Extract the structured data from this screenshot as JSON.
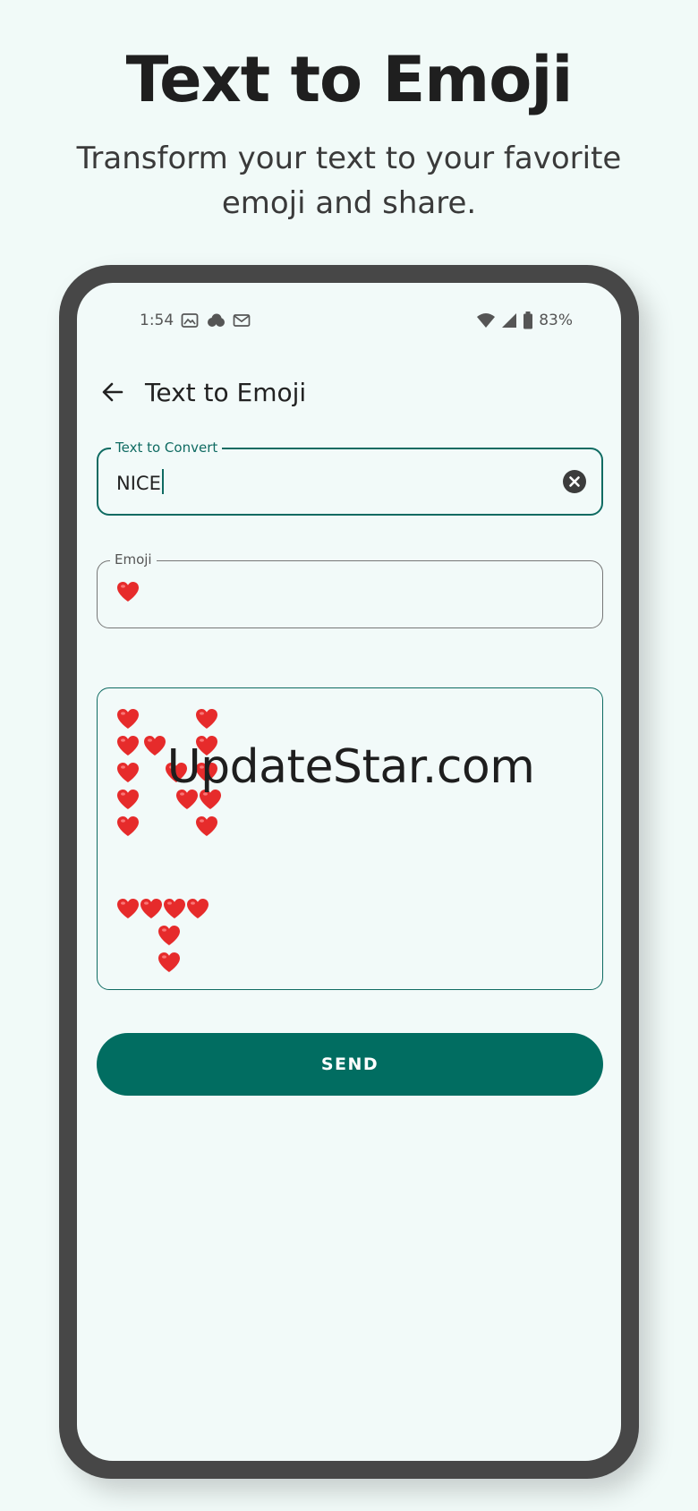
{
  "hero": {
    "title": "Text to Emoji",
    "subtitle": "Transform your text to your favorite emoji and share."
  },
  "status_bar": {
    "time": "1:54",
    "battery": "83%",
    "icons": [
      "gallery-icon",
      "cloud-icon",
      "mail-icon",
      "wifi-icon",
      "signal-icon",
      "battery-icon"
    ]
  },
  "app_bar": {
    "title": "Text to Emoji",
    "back_icon": "arrow-left-icon"
  },
  "text_field": {
    "label": "Text to Convert",
    "value": "NICE",
    "clear_icon": "clear-circle-icon"
  },
  "emoji_field": {
    "label": "Emoji",
    "value": "❤️"
  },
  "output": {
    "emoji": "❤️",
    "watermark": "UpdateStar.com"
  },
  "send_button": {
    "label": "SEND"
  },
  "colors": {
    "accent": "#016d61",
    "heart": "#e62b2b",
    "background": "#f1faf8",
    "phone_frame": "#474747"
  }
}
